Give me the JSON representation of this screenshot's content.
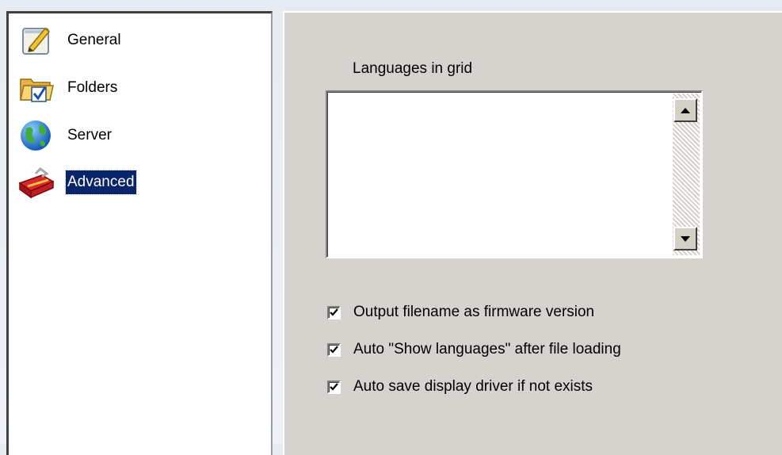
{
  "nav": {
    "items": [
      {
        "label": "General",
        "icon": "pencil-notepad-icon"
      },
      {
        "label": "Folders",
        "icon": "folder-checkmark-icon"
      },
      {
        "label": "Server",
        "icon": "globe-icon"
      },
      {
        "label": "Advanced",
        "icon": "toolbox-icon",
        "selected": true
      }
    ]
  },
  "advanced": {
    "languages_label": "Languages in grid",
    "languages_items": [],
    "options": [
      {
        "label": "Output filename as firmware version",
        "checked": true
      },
      {
        "label": "Auto \"Show languages\" after file loading",
        "checked": true
      },
      {
        "label": "Auto save display driver if not exists",
        "checked": true
      }
    ]
  },
  "colors": {
    "selection_bg": "#0a246a",
    "panel_bg": "#d6d3ce"
  }
}
